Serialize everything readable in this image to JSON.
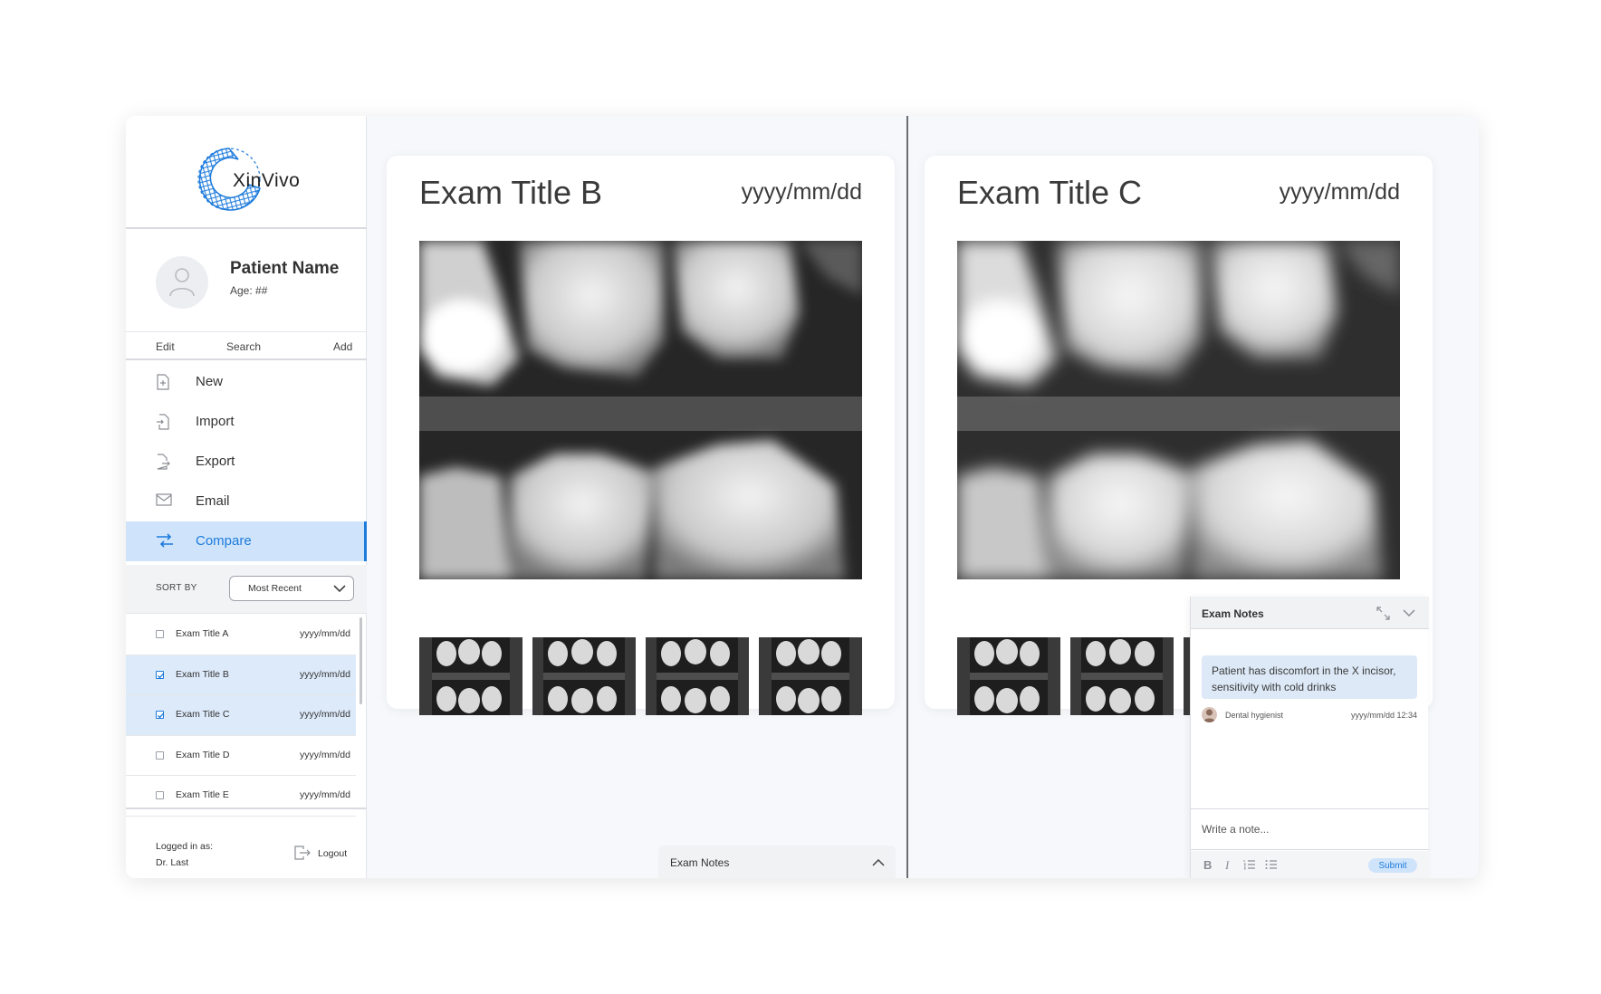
{
  "brand": {
    "name": "XinVivo",
    "accent": "#1d7bdc"
  },
  "patient": {
    "name": "Patient Name",
    "age": "Age: ##"
  },
  "actions": {
    "edit": "Edit",
    "search": "Search",
    "add": "Add"
  },
  "menu": [
    {
      "label": "New",
      "icon": "new-file-icon"
    },
    {
      "label": "Import",
      "icon": "import-file-icon"
    },
    {
      "label": "Export",
      "icon": "export-file-icon"
    },
    {
      "label": "Email",
      "icon": "email-icon"
    },
    {
      "label": "Compare",
      "icon": "compare-arrows-icon",
      "active": true
    }
  ],
  "sort": {
    "label": "SORT BY",
    "value": "Most Recent"
  },
  "exams": [
    {
      "title": "Exam Title A",
      "date": "yyyy/mm/dd",
      "checked": false
    },
    {
      "title": "Exam Title B",
      "date": "yyyy/mm/dd",
      "checked": true
    },
    {
      "title": "Exam Title C",
      "date": "yyyy/mm/dd",
      "checked": true
    },
    {
      "title": "Exam Title D",
      "date": "yyyy/mm/dd",
      "checked": false
    },
    {
      "title": "Exam Title E",
      "date": "yyyy/mm/dd",
      "checked": false
    }
  ],
  "footer": {
    "logged_label": "Logged in as:",
    "user": "Dr. Last",
    "logout": "Logout"
  },
  "cards": [
    {
      "title": "Exam Title B",
      "date": "yyyy/mm/dd"
    },
    {
      "title": "Exam Title C",
      "date": "yyyy/mm/dd"
    }
  ],
  "notes": {
    "title": "Exam Notes",
    "message": "Patient has discomfort in the X incisor, sensitivity with cold drinks",
    "author_role": "Dental hygienist",
    "timestamp": "yyyy/mm/dd 12:34",
    "placeholder": "Write a note...",
    "submit": "Submit",
    "tools": {
      "bold": "B",
      "italic": "I"
    }
  }
}
